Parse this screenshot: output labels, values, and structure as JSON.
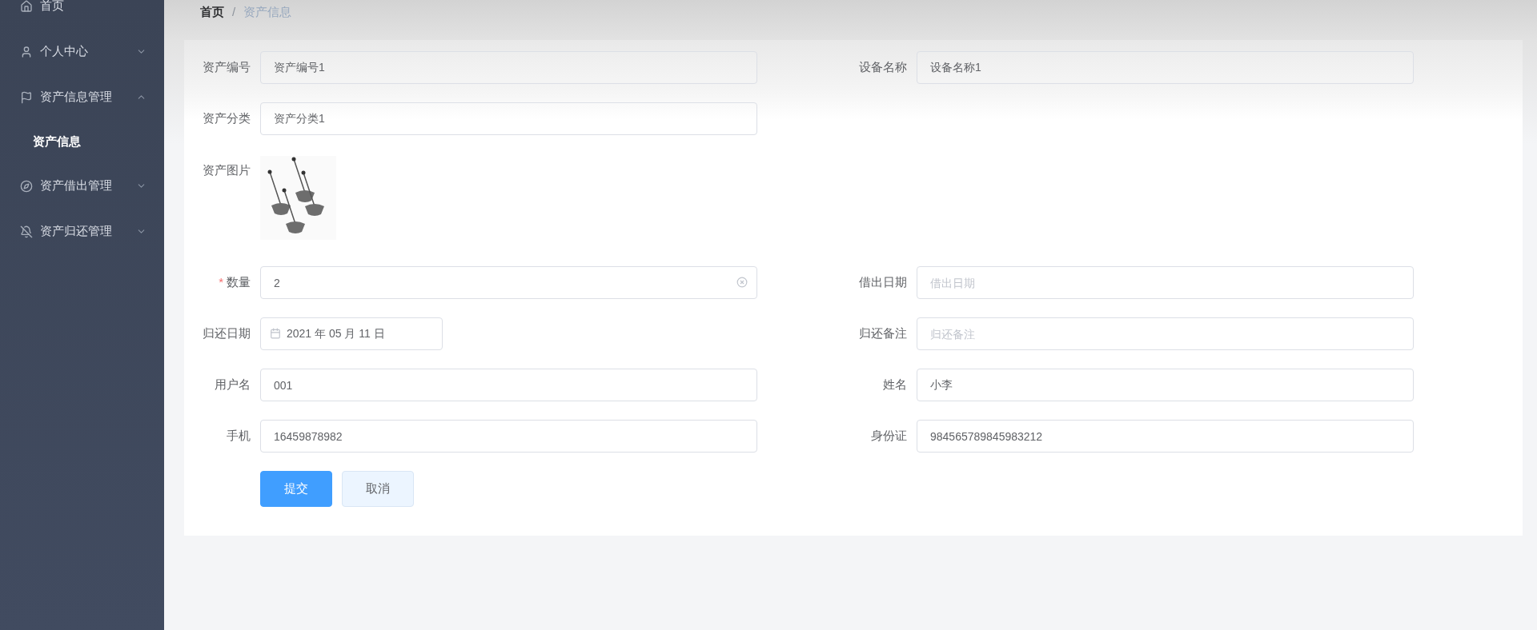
{
  "sidebar": {
    "items": [
      {
        "kind": "link",
        "label": "首页"
      },
      {
        "kind": "submenu",
        "label": "个人中心",
        "expanded": false
      },
      {
        "kind": "submenu",
        "label": "资产信息管理",
        "expanded": true,
        "children": [
          {
            "label": "资产信息",
            "selected": true
          }
        ]
      },
      {
        "kind": "submenu",
        "label": "资产借出管理",
        "expanded": false
      },
      {
        "kind": "submenu",
        "label": "资产归还管理",
        "expanded": false
      }
    ]
  },
  "breadcrumb": {
    "separator": "/",
    "items": [
      {
        "label": "首页",
        "current": false
      },
      {
        "label": "资产信息",
        "current": true
      }
    ]
  },
  "form": {
    "rows": [
      [
        {
          "kind": "text",
          "label": "资产编号",
          "value": "资产编号1"
        },
        {
          "kind": "text",
          "label": "设备名称",
          "value": "设备名称1"
        }
      ],
      [
        {
          "kind": "text",
          "label": "资产分类",
          "value": "资产分类1"
        }
      ],
      [
        {
          "kind": "image",
          "label": "资产图片"
        }
      ],
      [
        {
          "kind": "text",
          "label": "数量",
          "value": "2",
          "required_mark": "*",
          "clearable": true
        },
        {
          "kind": "text",
          "label": "借出日期",
          "placeholder": "借出日期"
        }
      ],
      [
        {
          "kind": "date",
          "label": "归还日期",
          "value": "2021 年 05 月 11 日"
        },
        {
          "kind": "text",
          "label": "归还备注",
          "placeholder": "归还备注"
        }
      ],
      [
        {
          "kind": "text",
          "label": "用户名",
          "value": "001"
        },
        {
          "kind": "text",
          "label": "姓名",
          "value": "小李"
        }
      ],
      [
        {
          "kind": "text",
          "label": "手机",
          "value": "16459878982"
        },
        {
          "kind": "text",
          "label": "身份证",
          "value": "984565789845983212"
        }
      ]
    ],
    "buttons": [
      {
        "kind": "primary",
        "label": "提交"
      },
      {
        "kind": "default",
        "label": "取消"
      }
    ]
  }
}
